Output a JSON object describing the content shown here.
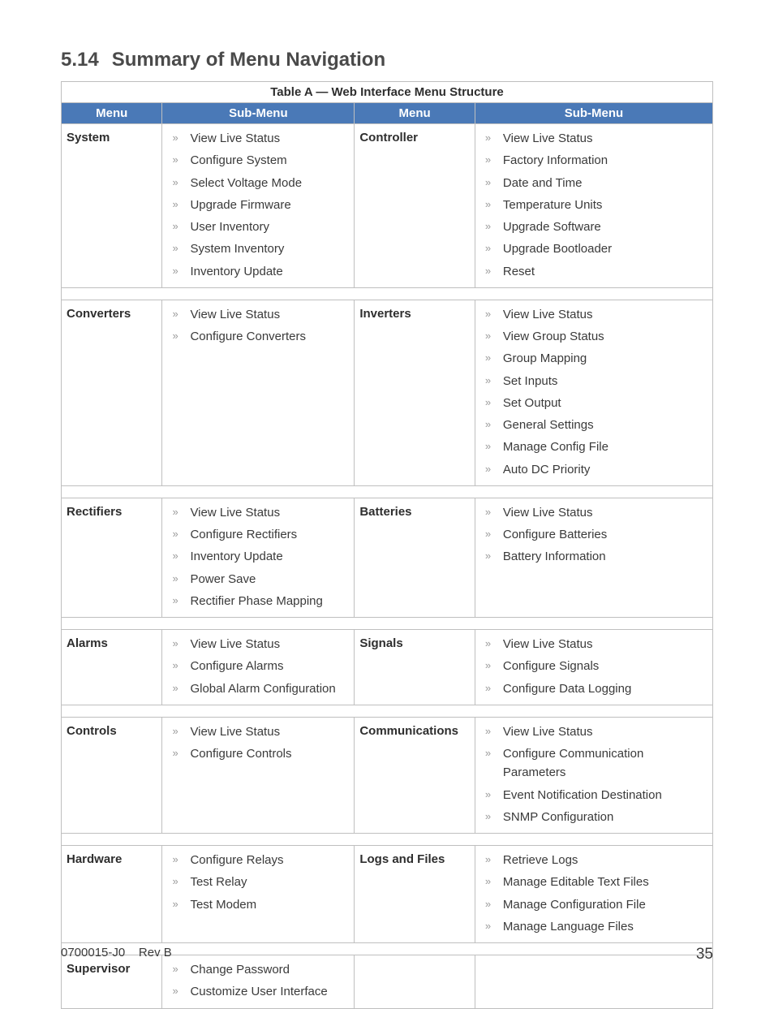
{
  "section_number": "5.14",
  "section_title": "Summary of Menu Navigation",
  "table_caption": "Table A  —  Web Interface Menu Structure",
  "header_menu": "Menu",
  "header_submenu": "Sub-Menu",
  "rows": [
    {
      "left_menu": "System",
      "left_sub": [
        "View Live Status",
        "Configure System",
        "Select Voltage Mode",
        "Upgrade Firmware",
        "User Inventory",
        "System Inventory",
        "Inventory Update"
      ],
      "right_menu": "Controller",
      "right_sub": [
        "View Live Status",
        "Factory Information",
        "Date and Time",
        "Temperature Units",
        "Upgrade Software",
        "Upgrade Bootloader",
        "Reset"
      ]
    },
    {
      "left_menu": "Converters",
      "left_sub": [
        "View Live Status",
        "Configure Converters"
      ],
      "right_menu": "Inverters",
      "right_sub": [
        "View Live Status",
        "View Group Status",
        "Group Mapping",
        "Set Inputs",
        "Set Output",
        "General Settings",
        "Manage Config File",
        "Auto DC Priority"
      ]
    },
    {
      "left_menu": "Rectifiers",
      "left_sub": [
        "View Live Status",
        "Configure Rectifiers",
        "Inventory Update",
        "Power Save",
        "Rectifier Phase Mapping"
      ],
      "right_menu": "Batteries",
      "right_sub": [
        "View Live Status",
        "Configure Batteries",
        "Battery Information"
      ]
    },
    {
      "left_menu": "Alarms",
      "left_sub": [
        "View Live Status",
        "Configure Alarms",
        "Global Alarm Configuration"
      ],
      "right_menu": "Signals",
      "right_sub": [
        "View Live Status",
        "Configure Signals",
        "Configure Data Logging"
      ]
    },
    {
      "left_menu": "Controls",
      "left_sub": [
        "View Live Status",
        "Configure Controls"
      ],
      "right_menu": "Communications",
      "right_sub": [
        "View Live Status",
        "Configure Communication Parameters",
        "Event Notification Destination",
        "SNMP Configuration"
      ]
    },
    {
      "left_menu": "Hardware",
      "left_sub": [
        "Configure Relays",
        "Test Relay",
        "Test Modem"
      ],
      "right_menu": "Logs and Files",
      "right_sub": [
        "Retrieve Logs",
        "Manage Editable Text Files",
        "Manage Configuration File",
        "Manage Language Files"
      ]
    },
    {
      "left_menu": "Supervisor",
      "left_sub": [
        "Change Password",
        "Customize User Interface"
      ],
      "right_menu": "",
      "right_sub": []
    }
  ],
  "footer_doc": "0700015-J0",
  "footer_rev": "Rev B",
  "footer_page": "35"
}
